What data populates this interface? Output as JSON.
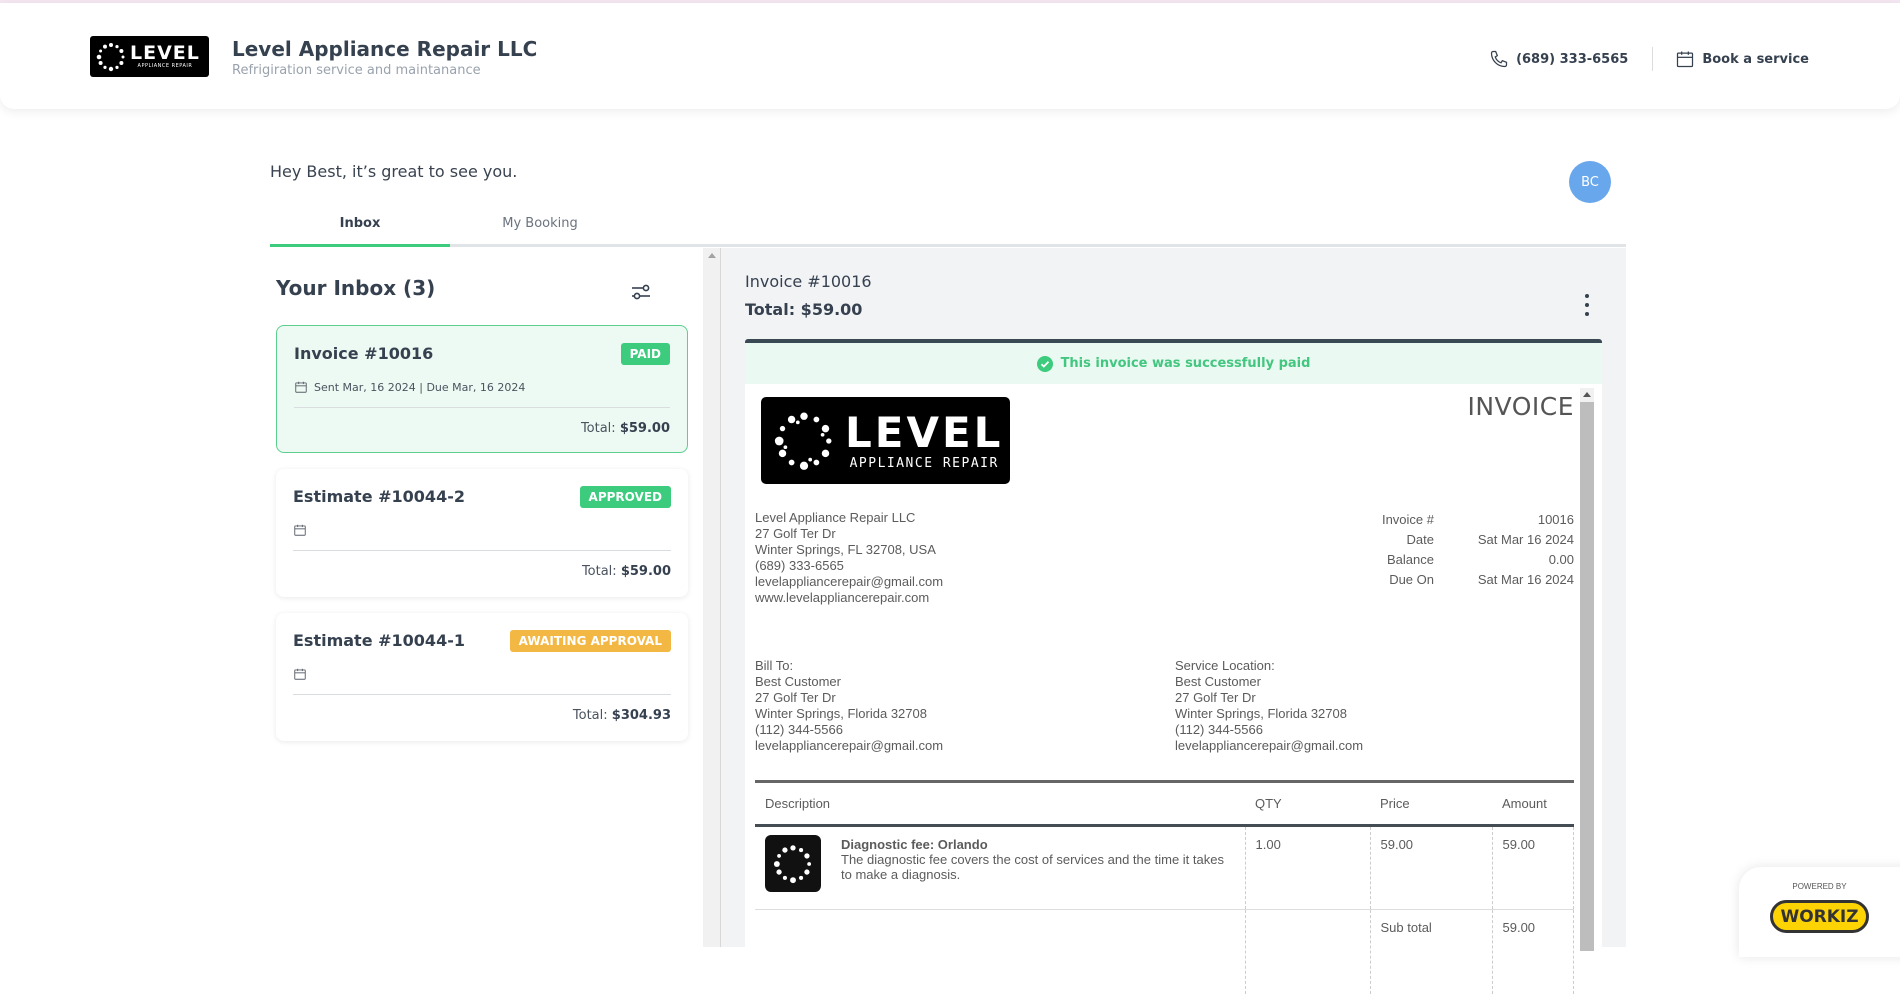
{
  "header": {
    "logo_big": "LEVEL",
    "logo_small": "APPLIANCE REPAIR",
    "company_name": "Level Appliance Repair LLC",
    "company_tagline": "Refrigiration service and maintanance",
    "phone": "(689) 333-6565",
    "book_label": "Book a service"
  },
  "greeting": "Hey Best, it’s great to see you.",
  "avatar_initials": "BC",
  "tabs": [
    {
      "label": "Inbox",
      "active": true
    },
    {
      "label": "My Booking",
      "active": false
    }
  ],
  "inbox": {
    "title": "Your Inbox (3)",
    "items": [
      {
        "title": "Invoice #10016",
        "badge": "PAID",
        "badge_color": "#3dcb7d",
        "dates": "Sent Mar, 16 2024 | Due Mar, 16 2024",
        "total_label": "Total:",
        "total": "$59.00",
        "selected": true
      },
      {
        "title": "Estimate #10044-2",
        "badge": "APPROVED",
        "badge_color": "#3dcb7d",
        "dates": "",
        "total_label": "Total:",
        "total": "$59.00",
        "selected": false
      },
      {
        "title": "Estimate #10044-1",
        "badge": "AWAITING APPROVAL",
        "badge_color": "#f3b844",
        "dates": "",
        "total_label": "Total:",
        "total": "$304.93",
        "selected": false
      }
    ]
  },
  "detail": {
    "title": "Invoice #10016",
    "total": "Total: $59.00",
    "paid_message": "This invoice was successfully paid",
    "document": {
      "heading": "INVOICE",
      "logo_big": "LEVEL",
      "logo_small": "APPLIANCE REPAIR",
      "from": [
        "Level Appliance Repair LLC",
        "27 Golf Ter Dr",
        "Winter Springs, FL 32708, USA",
        "(689) 333-6565",
        "levelappliancerepair@gmail.com",
        "www.levelappliancerepair.com"
      ],
      "meta": [
        {
          "k": "Invoice #",
          "v": "10016"
        },
        {
          "k": "Date",
          "v": "Sat Mar 16 2024"
        },
        {
          "k": "Balance",
          "v": "0.00"
        },
        {
          "k": "Due On",
          "v": "Sat Mar 16 2024"
        }
      ],
      "bill_to": [
        "Bill To:",
        "Best Customer",
        "27 Golf Ter Dr",
        "Winter Springs, Florida 32708",
        "(112) 344-5566",
        "levelappliancerepair@gmail.com"
      ],
      "service_location": [
        "Service Location:",
        "Best Customer",
        "27 Golf Ter Dr",
        "Winter Springs, Florida 32708",
        "(112) 344-5566",
        "levelappliancerepair@gmail.com"
      ],
      "columns": [
        "Description",
        "QTY",
        "Price",
        "Amount"
      ],
      "items": [
        {
          "name": "Diagnostic fee: Orlando",
          "description": "The diagnostic fee covers the cost of services and the time it takes to make a diagnosis.",
          "qty": "1.00",
          "price": "59.00",
          "amount": "59.00"
        }
      ],
      "subtotal_label": "Sub total",
      "subtotal": "59.00"
    }
  },
  "footer": {
    "powered_by": "POWERED BY",
    "brand": "WORKIZ"
  }
}
